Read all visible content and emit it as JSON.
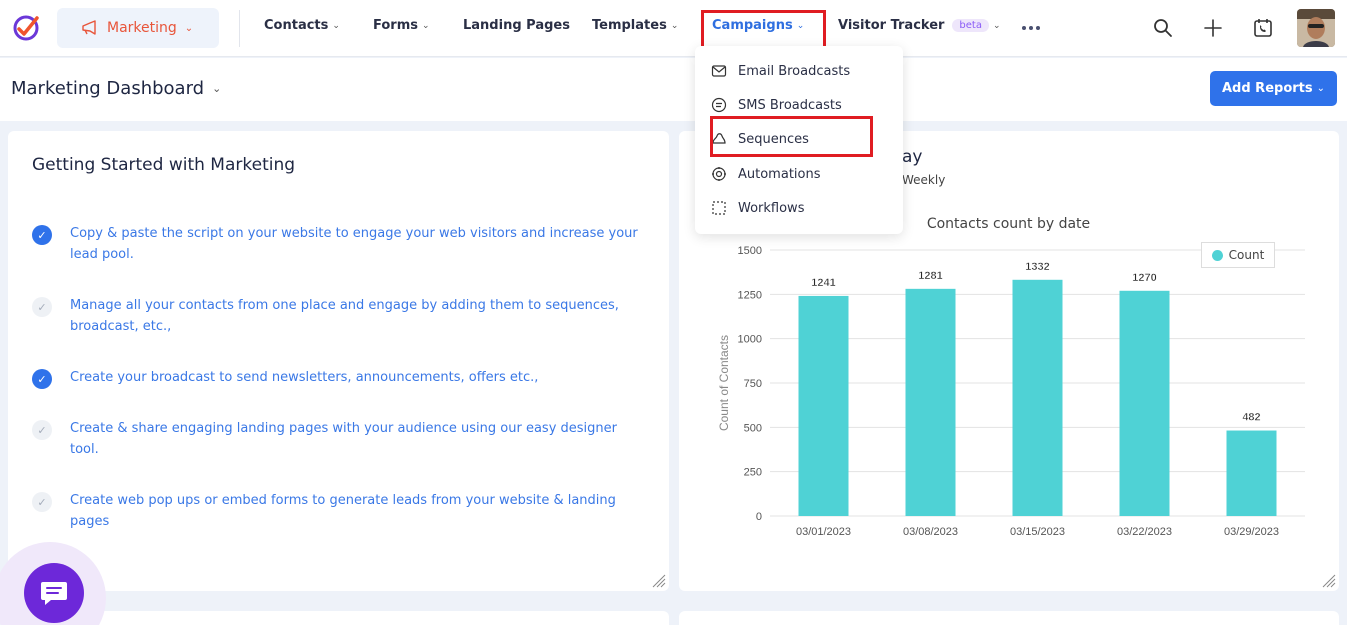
{
  "app_switcher": {
    "label": "Marketing"
  },
  "nav": {
    "items": [
      {
        "label": "Contacts",
        "has_menu": true
      },
      {
        "label": "Forms",
        "has_menu": true
      },
      {
        "label": "Landing Pages",
        "has_menu": false
      },
      {
        "label": "Templates",
        "has_menu": true
      },
      {
        "label": "Campaigns",
        "has_menu": true,
        "active": true
      },
      {
        "label": "Visitor Tracker",
        "has_menu": true,
        "badge": "beta"
      }
    ],
    "more_icon": "more-horizontal-icon"
  },
  "top_icons": [
    "search-icon",
    "plus-icon",
    "phone-calendar-icon"
  ],
  "page": {
    "title": "Marketing Dashboard"
  },
  "actions": {
    "add_reports_label": "Add Reports"
  },
  "campaigns_menu": {
    "items": [
      {
        "label": "Email Broadcasts",
        "icon": "mail-icon"
      },
      {
        "label": "SMS Broadcasts",
        "icon": "sms-icon"
      },
      {
        "label": "Sequences",
        "icon": "sequence-icon"
      },
      {
        "label": "Automations",
        "icon": "automation-icon"
      },
      {
        "label": "Workflows",
        "icon": "workflow-icon"
      }
    ]
  },
  "getting_started": {
    "title": "Getting Started with Marketing",
    "tasks": [
      {
        "text": "Copy & paste the script on your website to engage your web visitors and increase your lead pool.",
        "done": true
      },
      {
        "text": "Manage all your contacts from one place and engage by adding them to sequences, broadcast, etc.,",
        "done": false
      },
      {
        "text": "Create your broadcast to send newsletters, announcements, offers etc.,",
        "done": true
      },
      {
        "text": "Create & share engaging landing pages with your audience using our easy designer tool.",
        "done": false
      },
      {
        "text": "Create web pop ups or embed forms to generate leads from your website & landing pages",
        "done": false
      }
    ]
  },
  "chart_card": {
    "title_visible": "ay",
    "subtitle_visible": "Weekly"
  },
  "chart_data": {
    "type": "bar",
    "title": "Contacts count by date",
    "xlabel": "",
    "ylabel": "Count of Contacts",
    "categories": [
      "03/01/2023",
      "03/08/2023",
      "03/15/2023",
      "03/22/2023",
      "03/29/2023"
    ],
    "series": [
      {
        "name": "Count",
        "values": [
          1241,
          1281,
          1332,
          1270,
          482
        ]
      }
    ],
    "ylim": [
      0,
      1500
    ],
    "yticks": [
      0,
      250,
      500,
      750,
      1000,
      1250,
      1500
    ],
    "grid": true,
    "legend": "top-right",
    "color": "#4fd2d5"
  },
  "colors": {
    "accent": "#2f72ea",
    "brand": "#e8553a",
    "highlight": "#e01c22",
    "chat": "#6d28d9"
  }
}
